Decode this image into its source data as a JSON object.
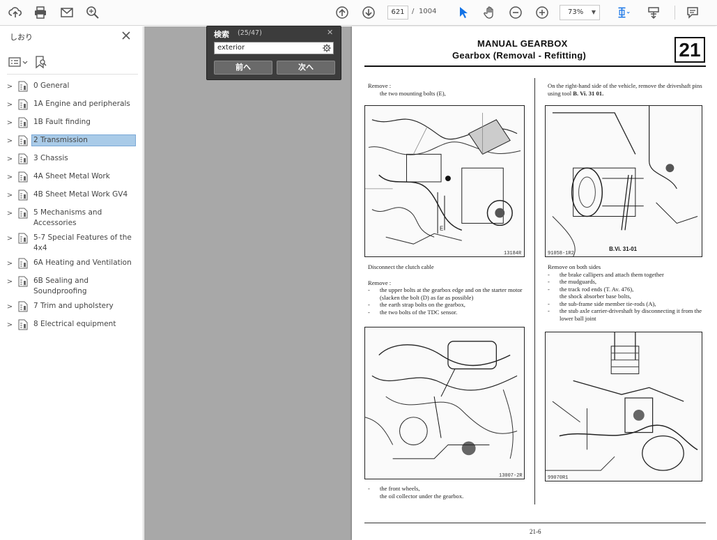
{
  "toolbar": {
    "page_current": "621",
    "page_sep": "/",
    "page_total": "1004",
    "zoom": "73%",
    "icons": [
      "upload-icon",
      "print-icon",
      "mail-icon",
      "zoom-search-icon",
      "page-up-icon",
      "page-down-icon",
      "select-cursor-icon",
      "hand-icon",
      "zoom-out-icon",
      "zoom-in-icon",
      "fit-page-icon",
      "scroll-mode-icon",
      "comment-icon"
    ]
  },
  "sidebar": {
    "title": "しおり",
    "items": [
      {
        "label": "0 General"
      },
      {
        "label": "1A Engine and peripherals"
      },
      {
        "label": "1B Fault finding"
      },
      {
        "label": "2 Transmission"
      },
      {
        "label": "3 Chassis"
      },
      {
        "label": "4A Sheet Metal Work"
      },
      {
        "label": "4B Sheet Metal Work GV4"
      },
      {
        "label": "5 Mechanisms and Accessories"
      },
      {
        "label": "5-7 Special Features of the 4x4"
      },
      {
        "label": "6A Heating and Ventilation"
      },
      {
        "label": "6B Sealing and Soundproofing"
      },
      {
        "label": "7 Trim and upholstery"
      },
      {
        "label": "8 Electrical equipment"
      }
    ],
    "selected_index": 3
  },
  "find": {
    "title": "検索",
    "count": "(25/47)",
    "query": "exterior",
    "prev_label": "前へ",
    "next_label": "次へ"
  },
  "document": {
    "header_line1": "MANUAL GEARBOX",
    "header_line2": "Gearbox (Removal - Refitting)",
    "section_number": "21",
    "left_col": {
      "block1_head": "Remove :",
      "block1_items": [
        "the two mounting bolts (E),"
      ],
      "fig1_code": "13184R",
      "caption2": "Disconnect the clutch cable",
      "block2_head": "Remove :",
      "block2_items": [
        "the upper bolts at the gearbox edge and on the starter motor (slacken the bolt (D) as far as possible)",
        "the earth strap bolts on the gearbox,",
        "the two bolts of the TDC sensor."
      ],
      "fig2_code": "13007-2R",
      "block3_items": [
        "the front wheels,"
      ],
      "block3_tail": "the oil collector under the gearbox."
    },
    "right_col": {
      "intro": "On the right-hand side of the vehicle, remove the driveshaft pins using tool",
      "tool": "B. Vi. 31 01.",
      "fig1_code": "91058-1R2",
      "fig1_label": "B.Vi. 31-01",
      "block2_head": "Remove on both sides",
      "block2_items": [
        "the brake callipers and attach them together",
        "the mudguards,",
        "the track rod ends (T. Av. 476),",
        "the shock absorber base bolts,",
        "the sub-frame side member tie-rods (A),",
        "the stub axle carrier-driveshaft by disconnecting it from the lower ball joint"
      ],
      "fig2_code": "99070R1"
    },
    "footer": "21-6"
  }
}
